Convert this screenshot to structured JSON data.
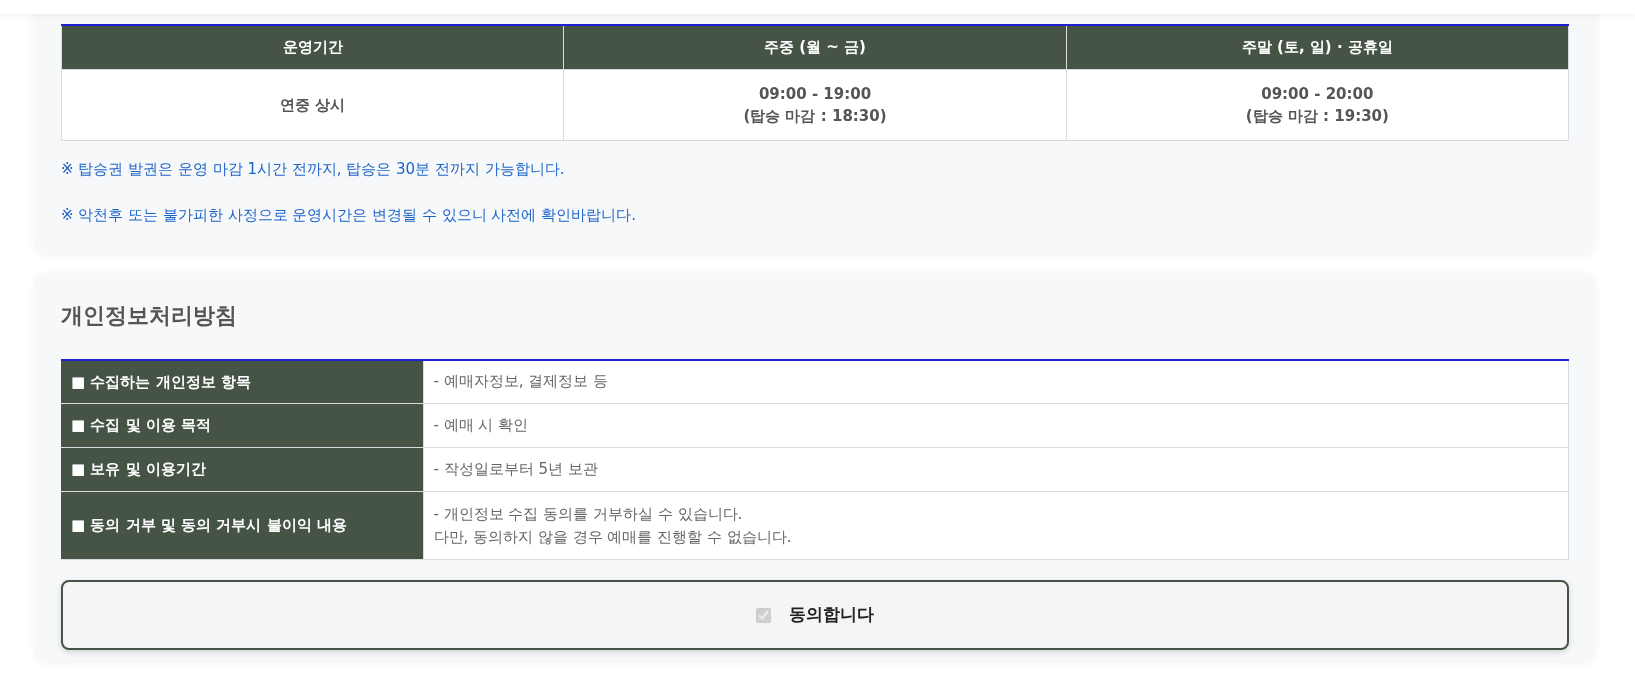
{
  "hours_table": {
    "columns": [
      "운영기간",
      "주중 (월 ~ 금)",
      "주말 (토, 일) · 공휴일"
    ],
    "rows": [
      {
        "cells": [
          [
            "연중 상시"
          ],
          [
            "09:00 - 19:00",
            "(탑승 마감 : 18:30)"
          ],
          [
            "09:00 - 20:00",
            "(탑승 마감 : 19:30)"
          ]
        ]
      }
    ]
  },
  "notes": [
    "※ 탑승권 발권은 운영 마감 1시간 전까지, 탑승은 30분 전까지 가능합니다.",
    "※ 악천후 또는 불가피한 사정으로 운영시간은 변경될 수 있으니 사전에 확인바랍니다."
  ],
  "privacy": {
    "title": "개인정보처리방침",
    "rows": [
      {
        "label": "■ 수집하는 개인정보 항목",
        "value": [
          "- 예매자정보, 결제정보 등"
        ]
      },
      {
        "label": "■ 수집 및 이용 목적",
        "value": [
          "- 예매 시 확인"
        ]
      },
      {
        "label": "■ 보유 및 이용기간",
        "value": [
          "- 작성일로부터 5년 보관"
        ]
      },
      {
        "label": "■ 동의 거부 및 동의 거부시 불이익 내용",
        "value": [
          "- 개인정보 수집 동의를 거부하실 수 있습니다.",
          "다만, 동의하지 않을 경우 예매를 진행할 수 없습니다."
        ]
      }
    ],
    "agree": {
      "label": "동의합니다",
      "checked": true,
      "disabled": true
    }
  }
}
